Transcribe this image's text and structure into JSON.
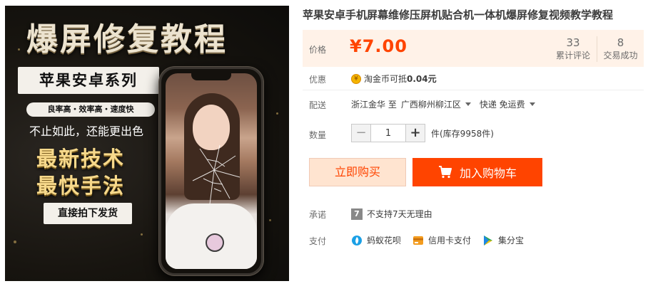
{
  "product_image": {
    "title": "爆屏修复教程",
    "series": "苹果安卓系列",
    "features": "良率高・效率高・速度快",
    "tagline": "不止如此，还能更出色",
    "slogan_1": "最新技术",
    "slogan_2": "最快手法",
    "buy_badge": "直接拍下发货"
  },
  "product": {
    "title": "苹果安卓手机屏幕维修压屏机贴合机一体机爆屏修复视频教学教程"
  },
  "price": {
    "label": "价格",
    "value": "¥7.00",
    "reviews_count": "33",
    "reviews_label": "累计评论",
    "sales_count": "8",
    "sales_label": "交易成功"
  },
  "promo": {
    "label": "优惠",
    "prefix": "淘金币可抵",
    "amount": "0.04元"
  },
  "shipping": {
    "label": "配送",
    "from": "浙江金华 至",
    "to": "广西柳州柳江区",
    "method": "快递 免运费"
  },
  "quantity": {
    "label": "数量",
    "minus": "−",
    "value": "1",
    "plus": "+",
    "stock": "件(库存9958件)"
  },
  "actions": {
    "buy_now": "立即购买",
    "add_to_cart": "加入购物车"
  },
  "promise": {
    "label": "承诺",
    "icon_text": "7",
    "text": "不支持7天无理由"
  },
  "payment": {
    "label": "支付",
    "methods": [
      {
        "name": "蚂蚁花呗",
        "icon": "huabei-icon",
        "color": "#1ba0e6"
      },
      {
        "name": "信用卡支付",
        "icon": "credit-card-icon",
        "color": "#f39c1f"
      },
      {
        "name": "集分宝",
        "icon": "jifenbao-icon",
        "color": "#2fa84f"
      }
    ]
  },
  "colors": {
    "accent": "#ff4400",
    "price_bg": "#fff2e8",
    "buy_now_bg": "#ffe4d0"
  }
}
